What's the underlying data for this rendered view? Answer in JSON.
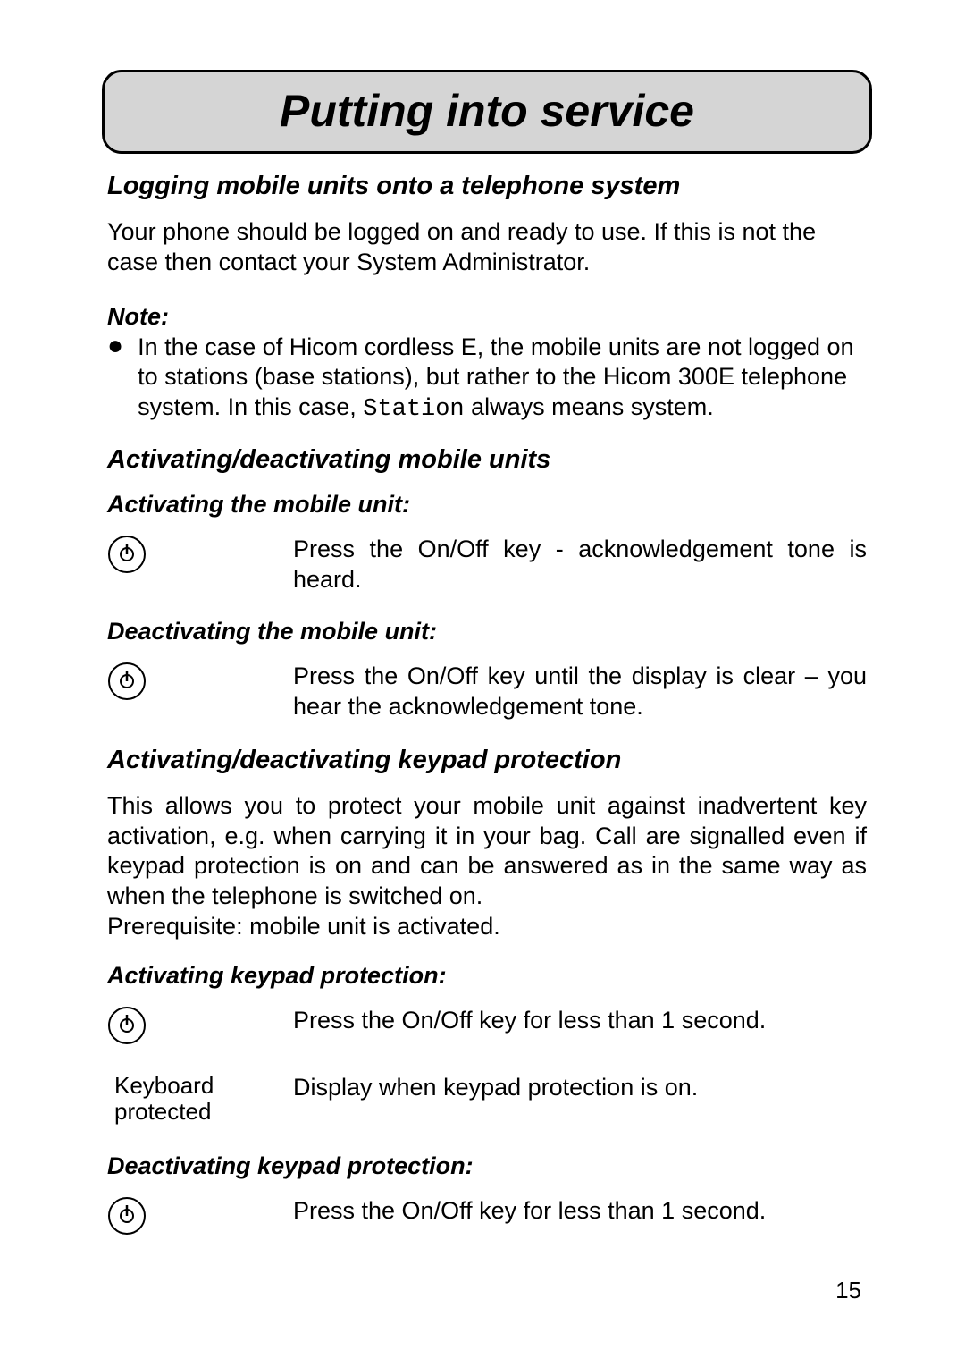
{
  "title": "Putting into service",
  "section1": {
    "heading": "Logging mobile units onto a telephone system",
    "para": "Your phone should be logged on and ready to use. If this is not the case then contact your System Administrator.",
    "note_label": "Note:",
    "note_bullet_pre": "In the case of Hicom cordless E, the mobile units are not logged on to stations (base stations), but rather to the Hicom 300E telephone system. In this case, ",
    "note_bullet_mono": "Station",
    "note_bullet_post": " always means system."
  },
  "section2": {
    "heading": "Activating/deactivating mobile units",
    "sub1": "Activating the mobile unit:",
    "step1": "Press the On/Off key - acknowledgement tone is heard.",
    "sub2": "Deactivating the mobile unit:",
    "step2": "Press the On/Off key until the display is clear – you hear the acknowledgement tone."
  },
  "section3": {
    "heading": "Activating/deactivating keypad protection",
    "para": "This allows you to protect your mobile unit against inadvertent key activation, e.g. when carrying it in your bag. Call are signalled even if keypad protection is on and can be answered as in the same way as when the telephone is switched on.",
    "prereq": "Prerequisite: mobile unit is activated.",
    "sub1": "Activating keypad protection:",
    "step1": "Press the On/Off key for less than 1 second.",
    "display_label_line1": "Keyboard",
    "display_label_line2": "protected",
    "display_desc": "Display when keypad protection is on.",
    "sub2": "Deactivating keypad protection:",
    "step2": "Press the On/Off key for less than 1 second."
  },
  "page_number": "15"
}
